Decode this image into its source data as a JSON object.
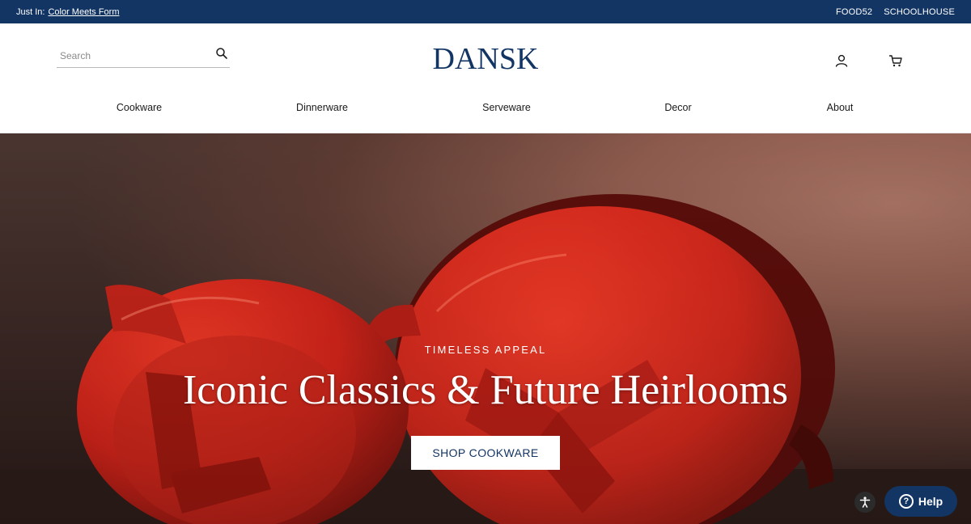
{
  "topbar": {
    "prefix": "Just In:",
    "link": "Color Meets Form",
    "brands": [
      "FOOD52",
      "SCHOOLHOUSE"
    ]
  },
  "header": {
    "logo": "DANSK",
    "search": {
      "placeholder": "Search"
    },
    "icons": [
      "search-icon",
      "account-icon",
      "cart-icon"
    ]
  },
  "nav": {
    "items": [
      {
        "label": "Cookware"
      },
      {
        "label": "Dinnerware"
      },
      {
        "label": "Serveware"
      },
      {
        "label": "Decor"
      },
      {
        "label": "About"
      }
    ]
  },
  "hero": {
    "eyebrow": "TIMELESS APPEAL",
    "headline": "Iconic Classics & Future Heirlooms",
    "cta": "SHOP COOKWARE"
  },
  "widgets": {
    "help_label": "Help"
  },
  "colors": {
    "brand_navy": "#133563",
    "cookware_red": "#d8291d"
  }
}
